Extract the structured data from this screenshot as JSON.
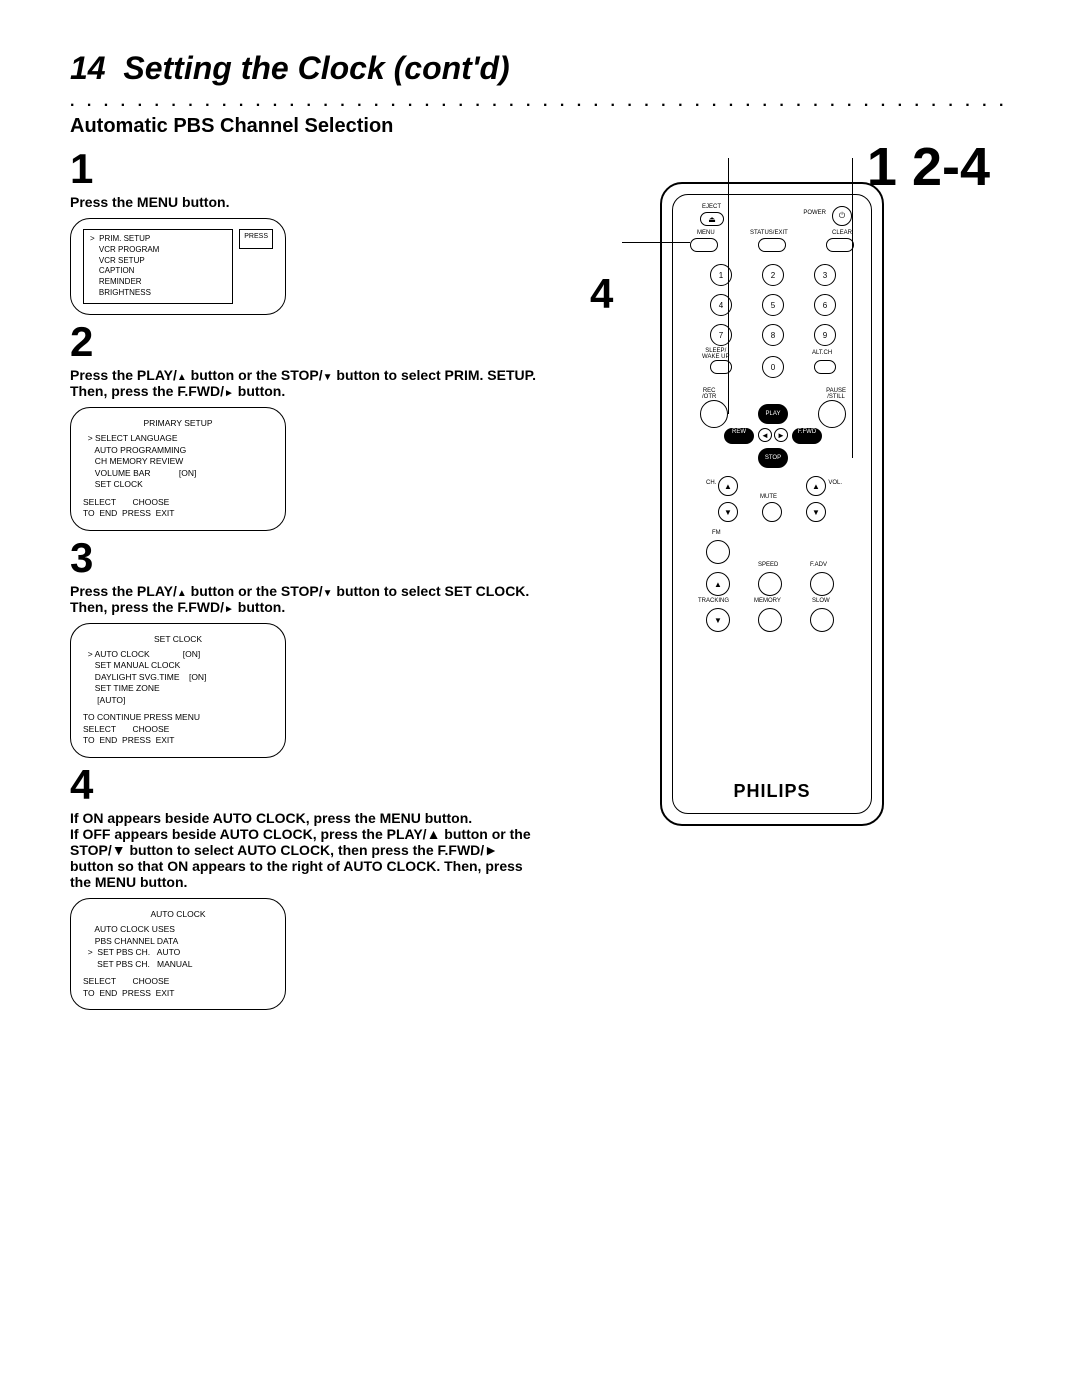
{
  "header": {
    "page_number": "14",
    "title": "Setting the Clock (cont'd)",
    "subtitle": "Automatic PBS Channel Selection"
  },
  "callouts": {
    "right_top": "1  2-4",
    "right_mid": "4"
  },
  "steps": {
    "s1": {
      "num": "1",
      "text": "Press the MENU button."
    },
    "s2": {
      "num": "2",
      "text_a": "Press the PLAY/",
      "text_b": "    button or the STOP/",
      "text_c": "    button to select PRIM. SETUP. Then, press the F.FWD/",
      "text_d": "    button."
    },
    "s3": {
      "num": "3",
      "text_a": "Press the PLAY/",
      "text_b": "    button or the STOP/",
      "text_c": "    button to select SET CLOCK. Then, press the F.FWD/",
      "text_d": "    button."
    },
    "s4": {
      "num": "4",
      "text": "If ON appears beside AUTO CLOCK, press the MENU button.\nIf OFF appears beside AUTO CLOCK, press the PLAY/▲ button or the STOP/▼ button to select AUTO CLOCK, then press the F.FWD/► button so that ON appears to the right of AUTO CLOCK. Then, press the MENU button."
    }
  },
  "screen1": {
    "press": "PRESS",
    "lines": [
      ">  PRIM. SETUP",
      "    VCR PROGRAM",
      "    VCR SETUP",
      "    CAPTION",
      "    REMINDER",
      "    BRIGHTNESS"
    ]
  },
  "screen2": {
    "hdr": "PRIMARY SETUP",
    "lines": [
      "  > SELECT LANGUAGE",
      "     AUTO PROGRAMMING",
      "     CH MEMORY REVIEW",
      "     VOLUME BAR            [ON]",
      "     SET CLOCK"
    ],
    "foot1": "SELECT       CHOOSE",
    "foot2": "TO  END  PRESS  EXIT"
  },
  "screen3": {
    "hdr": "SET CLOCK",
    "lines": [
      "  > AUTO CLOCK              [ON]",
      "     SET MANUAL CLOCK",
      "     DAYLIGHT SVG.TIME    [ON]",
      "     SET TIME ZONE",
      "      [AUTO]"
    ],
    "cont": "TO CONTINUE PRESS MENU",
    "foot1": "SELECT       CHOOSE",
    "foot2": "TO  END  PRESS  EXIT"
  },
  "screen4": {
    "hdr": "AUTO CLOCK",
    "lines": [
      "     AUTO CLOCK USES",
      "     PBS CHANNEL DATA",
      "",
      "  >  SET PBS CH.   AUTO",
      "      SET PBS CH.   MANUAL"
    ],
    "foot1": "SELECT       CHOOSE",
    "foot2": "TO  END  PRESS  EXIT"
  },
  "remote": {
    "brand": "PHILIPS",
    "labels": {
      "eject": "EJECT",
      "power": "POWER",
      "menu": "MENU",
      "status": "STATUS/EXIT",
      "clear": "CLEAR",
      "sleep": "SLEEP/\nWAKE UP",
      "altch": "ALT.CH",
      "rec": "REC\n/OTR",
      "pause": "PAUSE\n/STILL",
      "play": "PLAY",
      "rew": "REW",
      "ffwd": "F.FWD",
      "stop": "STOP",
      "ch": "CH.",
      "vol": "VOL.",
      "mute": "MUTE",
      "fm": "FM",
      "speed": "SPEED",
      "fadv": "F.ADV",
      "tracking": "TRACKING",
      "memory": "MEMORY",
      "slow": "SLOW"
    },
    "nums": [
      "1",
      "2",
      "3",
      "4",
      "5",
      "6",
      "7",
      "8",
      "9",
      "0"
    ]
  }
}
